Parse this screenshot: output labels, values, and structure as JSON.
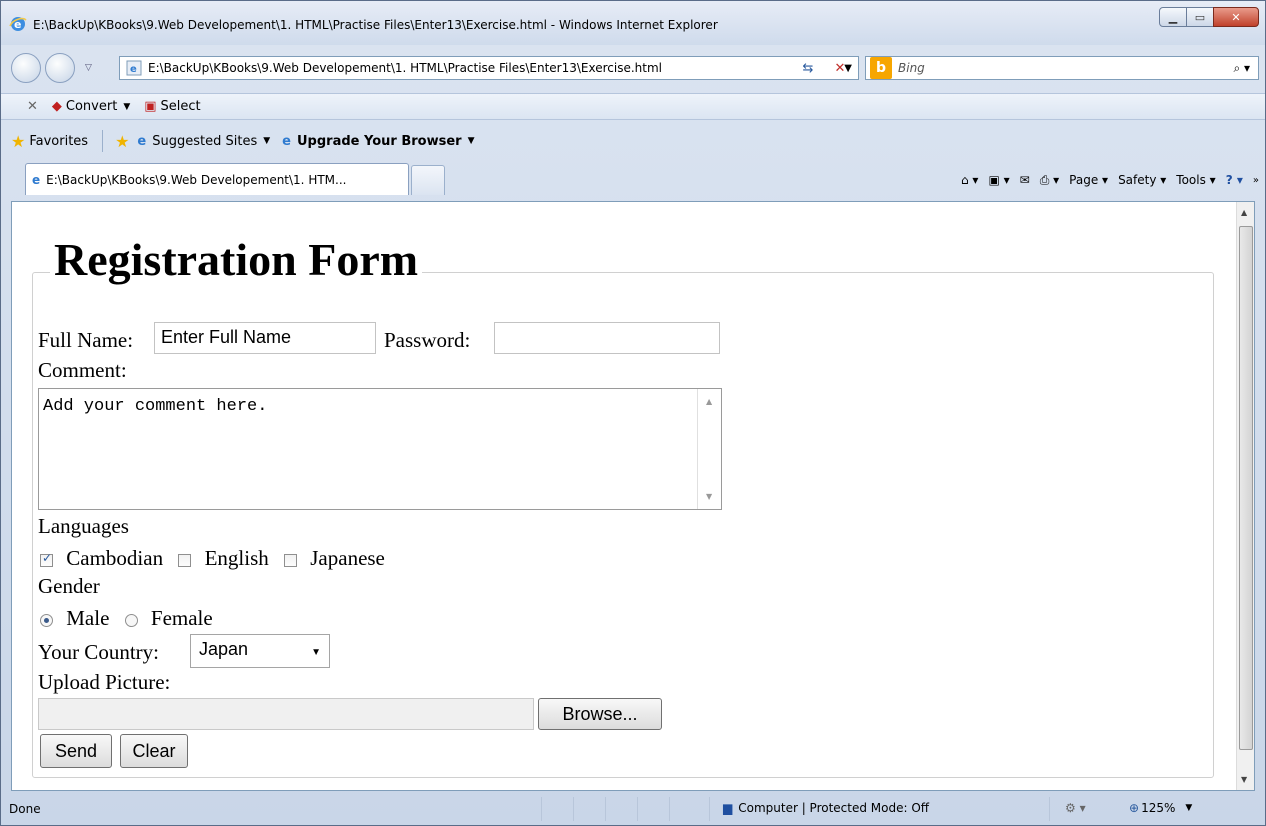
{
  "window": {
    "title": "E:\\BackUp\\KBooks\\9.Web Developement\\1. HTML\\Practise Files\\Enter13\\Exercise.html - Windows Internet Explorer",
    "address": "E:\\BackUp\\KBooks\\9.Web Developement\\1. HTML\\Practise Files\\Enter13\\Exercise.html",
    "search_placeholder": "Bing"
  },
  "command_bar": {
    "convert_label": "Convert",
    "select_label": "Select"
  },
  "favorites_bar": {
    "favorites_label": "Favorites",
    "suggested_label": "Suggested Sites",
    "upgrade_label": "Upgrade Your Browser"
  },
  "tab": {
    "label": "E:\\BackUp\\KBooks\\9.Web Developement\\1. HTM..."
  },
  "toolbar": {
    "page_label": "Page",
    "safety_label": "Safety",
    "tools_label": "Tools"
  },
  "form": {
    "legend": "Registration Form",
    "full_name_label": "Full Name:",
    "full_name_value": "Enter Full Name",
    "password_label": "Password:",
    "comment_label": "Comment:",
    "comment_value": "Add your comment here.",
    "languages_label": "Languages",
    "languages": [
      {
        "label": "Cambodian",
        "checked": true
      },
      {
        "label": "English",
        "checked": false
      },
      {
        "label": "Japanese",
        "checked": false
      }
    ],
    "gender_label": "Gender",
    "genders": [
      {
        "label": "Male",
        "selected": true
      },
      {
        "label": "Female",
        "selected": false
      }
    ],
    "country_label": "Your Country:",
    "country_value": "Japan",
    "upload_label": "Upload Picture:",
    "browse_label": "Browse...",
    "send_label": "Send",
    "clear_label": "Clear"
  },
  "status": {
    "text": "Done",
    "zone": "Computer | Protected Mode: Off",
    "zoom": "125%"
  }
}
